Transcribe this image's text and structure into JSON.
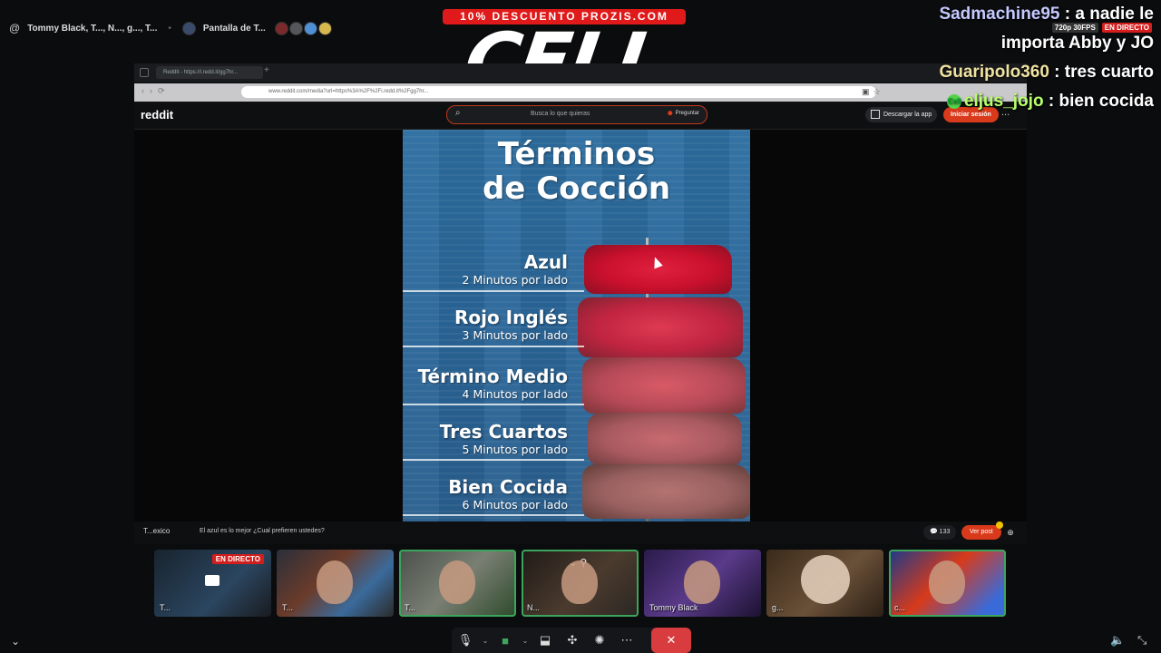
{
  "topbar": {
    "at_symbol": "@",
    "title": "Tommy Black, T..., N..., g..., T...",
    "stream_label": "Pantalla de T..."
  },
  "overlay": {
    "promo": "10% DESCUENTO PROZIS.COM",
    "logo": "CELL",
    "stream_quality": "720p 30FPS",
    "live_badge": "EN DIRECTO"
  },
  "chat": [
    {
      "user": "Sadmachine95",
      "message": " : a nadie le"
    },
    {
      "user": "",
      "message": "importa Abby y JO"
    },
    {
      "user": "Guaripolo360",
      "message": " : tres cuarto"
    },
    {
      "user": "eljus_jojo",
      "message": " : bien cocida",
      "badge": "Cell"
    }
  ],
  "browser": {
    "tab_title": "Reddit - https://i.redd.it/gg7hr...",
    "url": "www.reddit.com/media?url=https%3A%2F%2Fi.redd.it%2Fgg7hr..."
  },
  "reddit": {
    "logo": "reddit",
    "search_placeholder": "Busca lo que quieras",
    "ask_label": "Preguntar",
    "get_app": "Descargar la app",
    "login": "Iniciar sesión",
    "more": "...",
    "caption_user": "T...exico",
    "caption_text": "El azul es lo mejor ¿Cual prefieren ustedes?",
    "comments_count": "133",
    "view_post": "Ver post"
  },
  "poster": {
    "title_line1": "Términos",
    "title_line2": "de Cocción",
    "terms": [
      {
        "name": "Azul",
        "time": "2 Minutos por lado"
      },
      {
        "name": "Rojo Inglés",
        "time": "3 Minutos por lado"
      },
      {
        "name": "Término Medio",
        "time": "4 Minutos por lado"
      },
      {
        "name": "Tres Cuartos",
        "time": "5 Minutos por lado"
      },
      {
        "name": "Bien Cocida",
        "time": "6 Minutos por lado"
      }
    ]
  },
  "participants": [
    {
      "name": "T...",
      "live": "EN DIRECTO"
    },
    {
      "name": "T..."
    },
    {
      "name": "T..."
    },
    {
      "name": "N..."
    },
    {
      "name": "Tommy Black"
    },
    {
      "name": "g..."
    },
    {
      "name": "c..."
    }
  ],
  "colors": {
    "accent_red": "#d93a1b",
    "speaking_green": "#3ba55c",
    "hangup_red": "#d83c3e"
  }
}
